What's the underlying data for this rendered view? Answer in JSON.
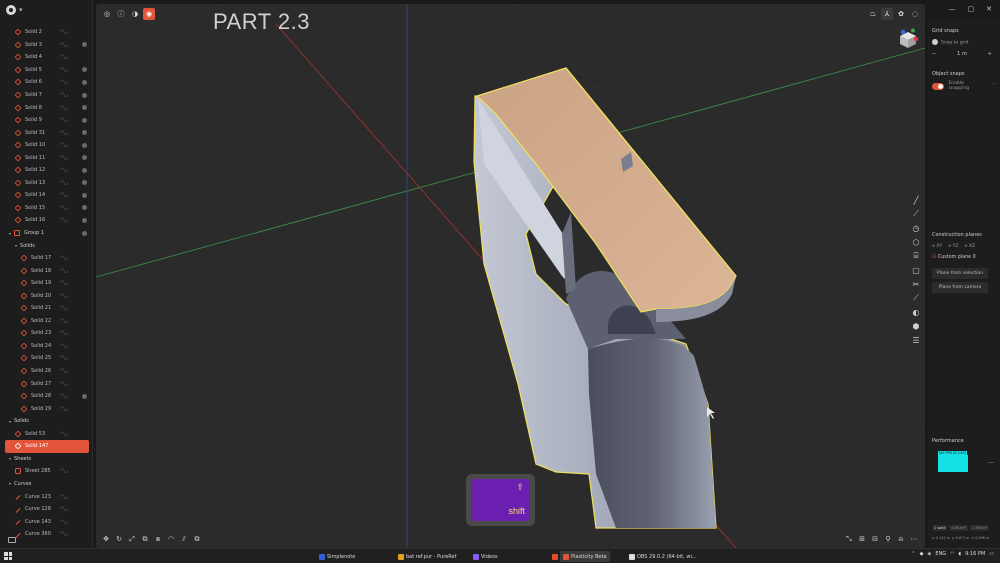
{
  "outliner": {
    "items": [
      {
        "label": "Solid 2",
        "type": "solid",
        "indent": 1,
        "dot": false
      },
      {
        "label": "Solid 3",
        "type": "solid",
        "indent": 1,
        "dot": true
      },
      {
        "label": "Solid 4",
        "type": "solid",
        "indent": 1,
        "dot": false
      },
      {
        "label": "Solid 5",
        "type": "solid",
        "indent": 1,
        "dot": true
      },
      {
        "label": "Solid 6",
        "type": "solid",
        "indent": 1,
        "dot": true
      },
      {
        "label": "Solid 7",
        "type": "solid",
        "indent": 1,
        "dot": true
      },
      {
        "label": "Solid 8",
        "type": "solid",
        "indent": 1,
        "dot": true
      },
      {
        "label": "Solid 9",
        "type": "solid",
        "indent": 1,
        "dot": true
      },
      {
        "label": "Solid 31",
        "type": "solid",
        "indent": 1,
        "dot": true
      },
      {
        "label": "Solid 10",
        "type": "solid",
        "indent": 1,
        "dot": true
      },
      {
        "label": "Solid 11",
        "type": "solid",
        "indent": 1,
        "dot": true
      },
      {
        "label": "Solid 12",
        "type": "solid",
        "indent": 1,
        "dot": true
      },
      {
        "label": "Solid 13",
        "type": "solid",
        "indent": 1,
        "dot": true
      },
      {
        "label": "Solid 14",
        "type": "solid",
        "indent": 1,
        "dot": true
      },
      {
        "label": "Solid 15",
        "type": "solid",
        "indent": 1,
        "dot": true
      },
      {
        "label": "Solid 16",
        "type": "solid",
        "indent": 1,
        "dot": true
      },
      {
        "label": "Group 1",
        "type": "group",
        "indent": 0,
        "dot": true,
        "header": true
      },
      {
        "label": "Solids",
        "type": "section",
        "indent": 1,
        "dot": false,
        "header": true
      },
      {
        "label": "Solid 17",
        "type": "solid",
        "indent": 2,
        "dot": false
      },
      {
        "label": "Solid 18",
        "type": "solid",
        "indent": 2,
        "dot": false
      },
      {
        "label": "Solid 19",
        "type": "solid",
        "indent": 2,
        "dot": false
      },
      {
        "label": "Solid 20",
        "type": "solid",
        "indent": 2,
        "dot": false
      },
      {
        "label": "Solid 21",
        "type": "solid",
        "indent": 2,
        "dot": false
      },
      {
        "label": "Solid 22",
        "type": "solid",
        "indent": 2,
        "dot": false
      },
      {
        "label": "Solid 23",
        "type": "solid",
        "indent": 2,
        "dot": false
      },
      {
        "label": "Solid 24",
        "type": "solid",
        "indent": 2,
        "dot": false
      },
      {
        "label": "Solid 25",
        "type": "solid",
        "indent": 2,
        "dot": false
      },
      {
        "label": "Solid 26",
        "type": "solid",
        "indent": 2,
        "dot": false
      },
      {
        "label": "Solid 27",
        "type": "solid",
        "indent": 2,
        "dot": false
      },
      {
        "label": "Solid 28",
        "type": "solid",
        "indent": 2,
        "dot": true
      },
      {
        "label": "Solid 29",
        "type": "solid",
        "indent": 2,
        "dot": false
      },
      {
        "label": "Solids",
        "type": "section",
        "indent": 0,
        "dot": false,
        "header": true
      },
      {
        "label": "Solid 53",
        "type": "solid",
        "indent": 1,
        "dot": false
      },
      {
        "label": "Solid 147",
        "type": "solid",
        "indent": 1,
        "dot": false,
        "selected": true
      },
      {
        "label": "Sheets",
        "type": "section",
        "indent": 0,
        "dot": false,
        "header": true
      },
      {
        "label": "Sheet 285",
        "type": "sheet",
        "indent": 1,
        "dot": false
      },
      {
        "label": "Curves",
        "type": "section",
        "indent": 0,
        "dot": false,
        "header": true
      },
      {
        "label": "Curve 123",
        "type": "curve",
        "indent": 1,
        "dot": false
      },
      {
        "label": "Curve 128",
        "type": "curve",
        "indent": 1,
        "dot": false
      },
      {
        "label": "Curve 143",
        "type": "curve",
        "indent": 1,
        "dot": false
      },
      {
        "label": "Curve 360",
        "type": "curve",
        "indent": 1,
        "dot": false
      }
    ]
  },
  "viewport": {
    "overlay_title": "PART 2.3",
    "key_overlay": {
      "label": "shift",
      "arrow": "⇧"
    }
  },
  "properties": {
    "grid_snaps": {
      "title": "Grid snaps",
      "snap_to_grid": "Snap to grid",
      "minus": "−",
      "value": "1 m",
      "plus": "+"
    },
    "object_snaps": {
      "title": "Object snaps",
      "enable": "Enable",
      "snapping": "snapping",
      "more": "…"
    },
    "construction_planes": {
      "title": "Construction planes",
      "xy": "XY",
      "yz": "YZ",
      "xz": "XZ",
      "custom_plane": "Custom plane 0",
      "from_selection": "Plane from selection",
      "from_camera": "Plane from camera"
    },
    "performance": {
      "title": "Performance",
      "fps_label": "NO FPS (0-140)",
      "more": "…"
    },
    "stats": {
      "count": "1 solid",
      "a": "0.003m³",
      "b": "2.051m²",
      "c": "x: 0.141 m",
      "d": "y: 0.071 m",
      "e": "z: 0.296 m"
    }
  },
  "taskbar": {
    "apps": [
      {
        "label": "Simplenote",
        "color": "#3360d8",
        "active": false
      },
      {
        "label": "bat ref.pur - PureRef",
        "color": "#e0a020",
        "active": false
      },
      {
        "label": "Videos",
        "color": "#8b5cf6",
        "active": false
      },
      {
        "label": "",
        "color": "#e44d2a",
        "active": false
      },
      {
        "label": "Plasticity Beta",
        "color": "#e2553b",
        "active": true
      },
      {
        "label": "OBS 29.0.2 (64-bit, wi...",
        "color": "#dddddd",
        "active": false
      }
    ],
    "lang": "ENG",
    "time": "9:16 PM"
  },
  "colors": {
    "accent": "#e2553b",
    "model_face": "#d8ad8c",
    "model_side": "#aab0c0",
    "outline": "#f0e060",
    "fps": "#14e2e6"
  }
}
